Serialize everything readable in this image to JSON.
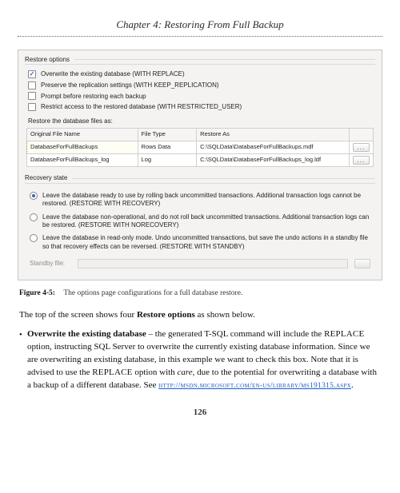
{
  "chapter_title": "Chapter 4: Restoring From Full Backup",
  "restore_options": {
    "group_title": "Restore options",
    "checks": [
      {
        "checked": true,
        "label": "Overwrite the existing database (WITH REPLACE)"
      },
      {
        "checked": false,
        "label": "Preserve the replication settings (WITH KEEP_REPLICATION)"
      },
      {
        "checked": false,
        "label": "Prompt before restoring each backup"
      },
      {
        "checked": false,
        "label": "Restrict access to the restored database (WITH RESTRICTED_USER)"
      }
    ],
    "files_label": "Restore the database files as:",
    "table": {
      "headers": [
        "Original File Name",
        "File Type",
        "Restore As",
        ""
      ],
      "rows": [
        {
          "name": "DatabaseForFullBackups",
          "type": "Rows Data",
          "restore_as": "C:\\SQLData\\DatabaseForFullBackups.mdf",
          "selected": true
        },
        {
          "name": "DatabaseForFullBackups_log",
          "type": "Log",
          "restore_as": "C:\\SQLData\\DatabaseForFullBackups_log.ldf",
          "selected": false
        }
      ],
      "ellipsis": "..."
    }
  },
  "recovery_state": {
    "group_title": "Recovery state",
    "options": [
      {
        "checked": true,
        "text": "Leave the database ready to use by rolling back uncommitted transactions. Additional transaction logs cannot be restored. (RESTORE WITH RECOVERY)"
      },
      {
        "checked": false,
        "text": "Leave the database non-operational, and do not roll back uncommitted transactions. Additional transaction logs can be restored. (RESTORE WITH NORECOVERY)"
      },
      {
        "checked": false,
        "text": "Leave the database in read-only mode. Undo uncommitted transactions, but save the undo actions in a standby file so that recovery effects can be reversed. (RESTORE WITH STANDBY)"
      }
    ],
    "standby_label": "Standby file:"
  },
  "caption": {
    "label": "Figure 4-5:",
    "text": "The options page configurations for a full database restore."
  },
  "body": {
    "intro_pre": "The top of the screen shows four ",
    "intro_bold": "Restore options",
    "intro_post": " as shown below.",
    "bullet": {
      "lead_bold": "Overwrite the existing database",
      "seg1": " – the generated T-SQL command will include the ",
      "kw1": "REPLACE",
      "seg2": " option, instructing SQL Server to overwrite the currently existing database information. Since we are overwriting an existing database, in this example we want to check this box. Note that it is advised to use the ",
      "kw2": "REPLACE",
      "seg3": " option with ",
      "italic": "care",
      "seg4": ", due to the potential for overwriting a database with a backup of a different database. See ",
      "link": "http://msdn.microsoft.com/en-us/library/ms191315.aspx",
      "period": "."
    }
  },
  "page_number": "126"
}
